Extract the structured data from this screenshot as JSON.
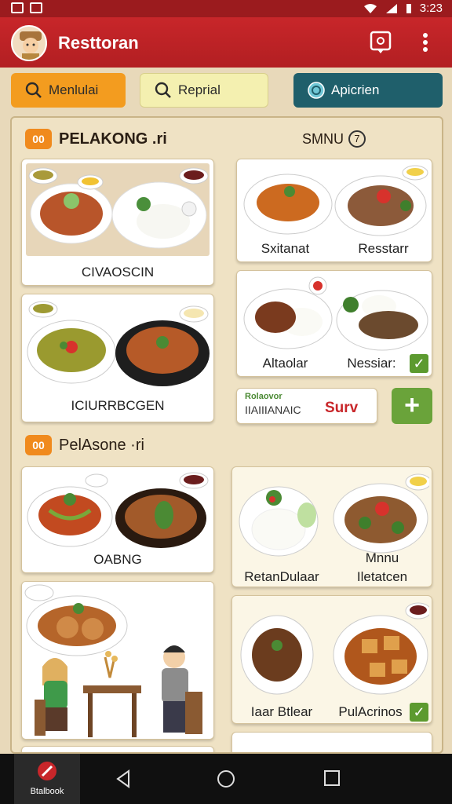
{
  "status_bar": {
    "time": "3:23"
  },
  "app_bar": {
    "title": "Resttoran"
  },
  "chips": [
    {
      "label": "Menlulai",
      "bg": "#f39c1f"
    },
    {
      "label": "Reprial",
      "bg": "#f4f0b0"
    },
    {
      "label": "Apicrien",
      "bg": "#1f5f6b"
    }
  ],
  "section1": {
    "badge": "00",
    "title": "PELAKONG .ri",
    "side_title": "SMNU",
    "side_icon_text": "7"
  },
  "section2": {
    "badge": "00",
    "title": "PelAsone ·ri"
  },
  "cards": {
    "left1": "CIVAOSCIN",
    "left2": "ICIURRBCGEN",
    "right1a": "Sxitanat",
    "right1b": "Resstarr",
    "right2a": "Altaolar",
    "right2b": "Nessiar:",
    "promo_small": "Rolaovor",
    "promo_main": "IIAIIIANAIC",
    "promo_accent": "Surv",
    "left3": "OABNG",
    "right3a": "RetanDulaar",
    "right3b_line1": "Mnnu",
    "right3b_line2": "Iletatcen",
    "right4a": "Iaar Btlear",
    "right4b": "PulAcrinos"
  },
  "nav": {
    "home_label": "Btalbook"
  },
  "colors": {
    "appbar": "#c8262a",
    "accent_orange": "#f08a1d",
    "check_green": "#5c9a2f"
  }
}
